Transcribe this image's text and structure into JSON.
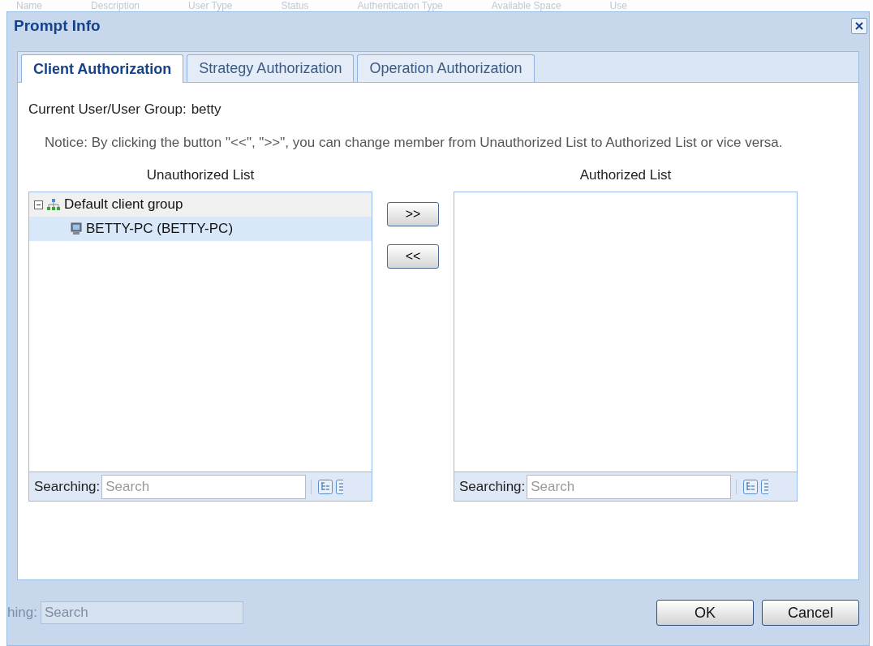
{
  "background_table": {
    "columns": [
      "Name",
      "Description",
      "User Type",
      "Status",
      "Authentication Type",
      "Available Space",
      "Use"
    ]
  },
  "background_search": {
    "label": "hing:",
    "placeholder": "Search"
  },
  "window": {
    "title": "Prompt Info"
  },
  "tabs": [
    {
      "label": "Client Authorization",
      "selected": true
    },
    {
      "label": "Strategy Authorization",
      "selected": false
    },
    {
      "label": "Operation Authorization",
      "selected": false
    }
  ],
  "current_user": {
    "label": "Current User/User Group:",
    "value": "betty"
  },
  "notice": "Notice: By clicking the button \"<<\", \">>\", you can change member from Unauthorized List to Authorized List or vice versa.",
  "unauthorized": {
    "title": "Unauthorized List",
    "tree": [
      {
        "label": "Default client group",
        "expanded": true,
        "selected": false,
        "children": [
          {
            "label": "BETTY-PC (BETTY-PC)",
            "selected": true
          }
        ]
      }
    ],
    "search_label": "Searching:",
    "search_placeholder": "Search"
  },
  "move_buttons": [
    ">>",
    "<<"
  ],
  "authorized": {
    "title": "Authorized List",
    "search_label": "Searching:",
    "search_placeholder": "Search"
  },
  "buttons": [
    "OK",
    "Cancel"
  ]
}
